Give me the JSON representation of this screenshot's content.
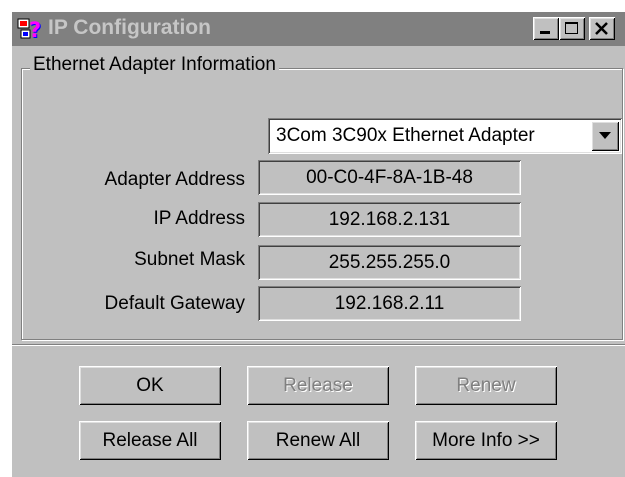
{
  "window": {
    "title": "IP Configuration",
    "icon": "help-network-icon",
    "controls": [
      "minimize-icon",
      "maximize-icon",
      "close-icon"
    ]
  },
  "group": {
    "label": "Ethernet  Adapter Information"
  },
  "adapter_select": {
    "selected": "3Com 3C90x Ethernet Adapter"
  },
  "fields": [
    {
      "label": "Adapter Address",
      "value": "00-C0-4F-8A-1B-48"
    },
    {
      "label": "IP Address",
      "value": "192.168.2.131"
    },
    {
      "label": "Subnet Mask",
      "value": "255.255.255.0"
    },
    {
      "label": "Default Gateway",
      "value": "192.168.2.11"
    }
  ],
  "buttons": {
    "ok": "OK",
    "release": "Release",
    "renew": "Renew",
    "release_all": "Release All",
    "renew_all": "Renew All",
    "more_info": "More Info >>"
  },
  "colors": {
    "face": "#c0c0c0",
    "titlebar_inactive": "#808080",
    "disabled_text": "#808080"
  }
}
